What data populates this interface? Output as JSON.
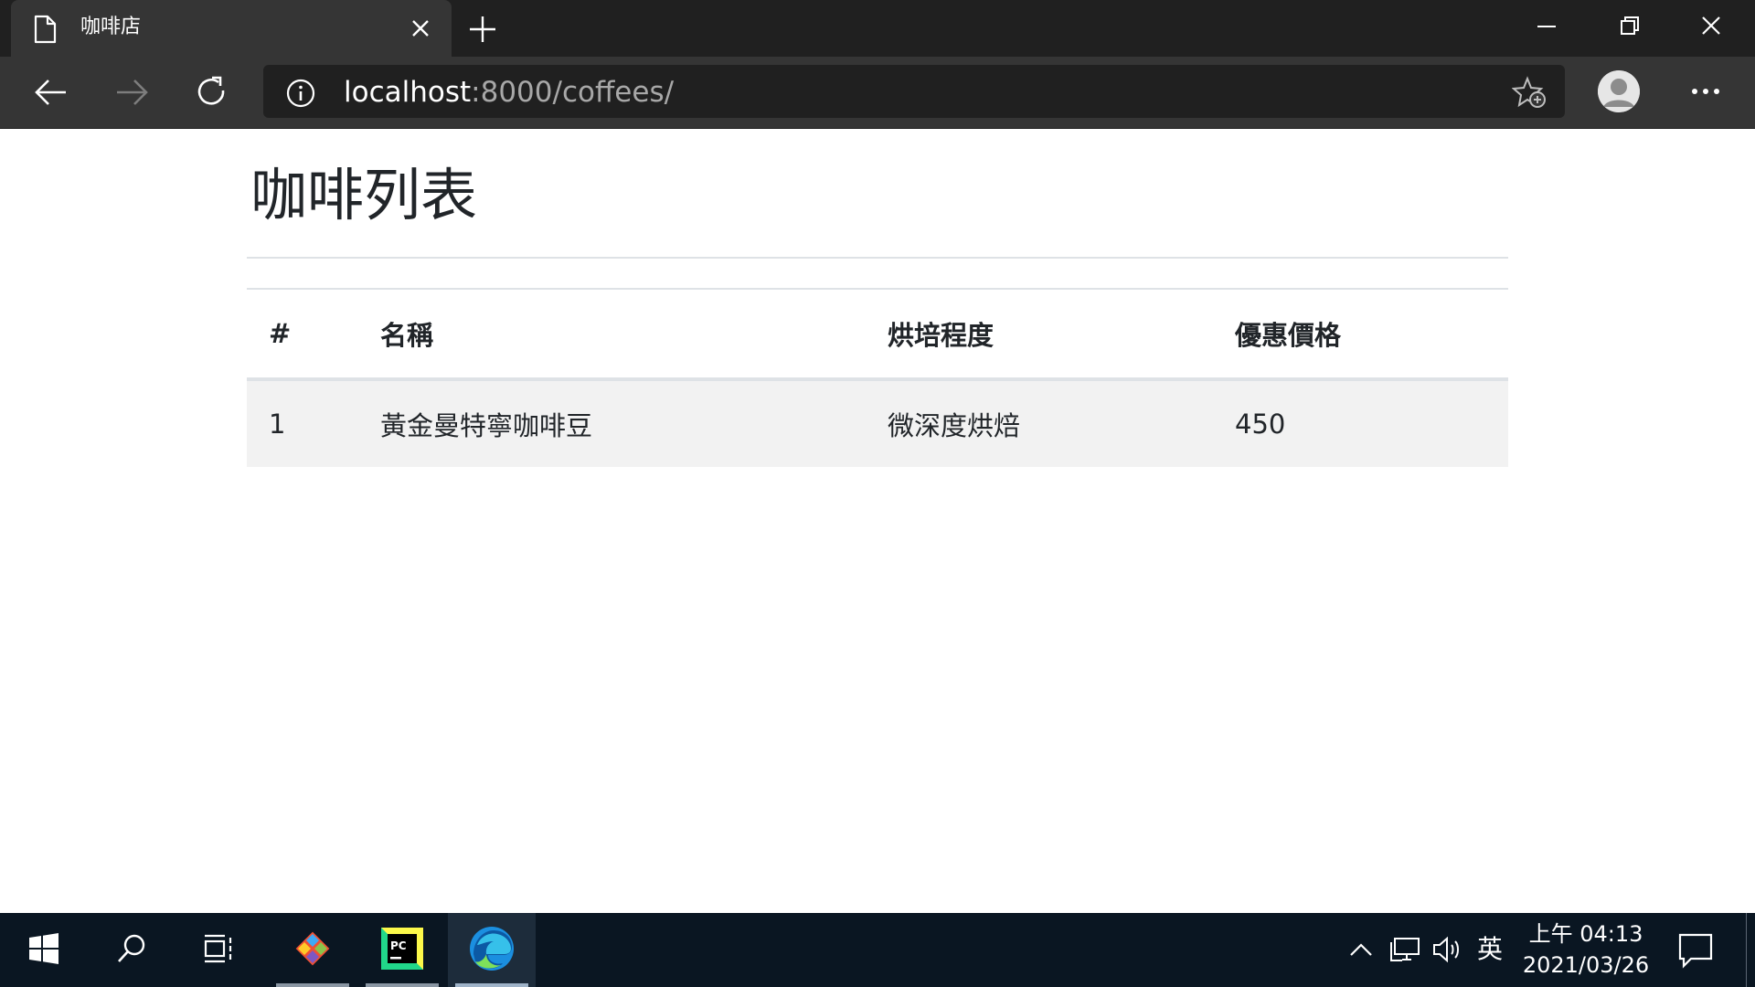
{
  "browser": {
    "tab": {
      "title": "咖啡店",
      "icon": "page-icon"
    },
    "address": {
      "host": "localhost",
      "rest": ":8000/coffees/"
    }
  },
  "page": {
    "title": "咖啡列表",
    "table": {
      "headers": [
        "#",
        "名稱",
        "烘培程度",
        "優惠價格"
      ],
      "rows": [
        [
          "1",
          "黃金曼特寧咖啡豆",
          "微深度烘焙",
          "450"
        ]
      ]
    }
  },
  "taskbar": {
    "pinned": [
      "windows-start-icon",
      "search-icon",
      "task-view-icon",
      "git-icon",
      "pycharm-icon",
      "edge-icon"
    ],
    "tray": {
      "ime": "英",
      "time": "上午 04:13",
      "date": "2021/03/26"
    }
  },
  "colors": {
    "chrome_dark": "#202020",
    "chrome_mid": "#353535",
    "taskbar": "#0a1622",
    "row_stripe": "#f2f2f2"
  }
}
